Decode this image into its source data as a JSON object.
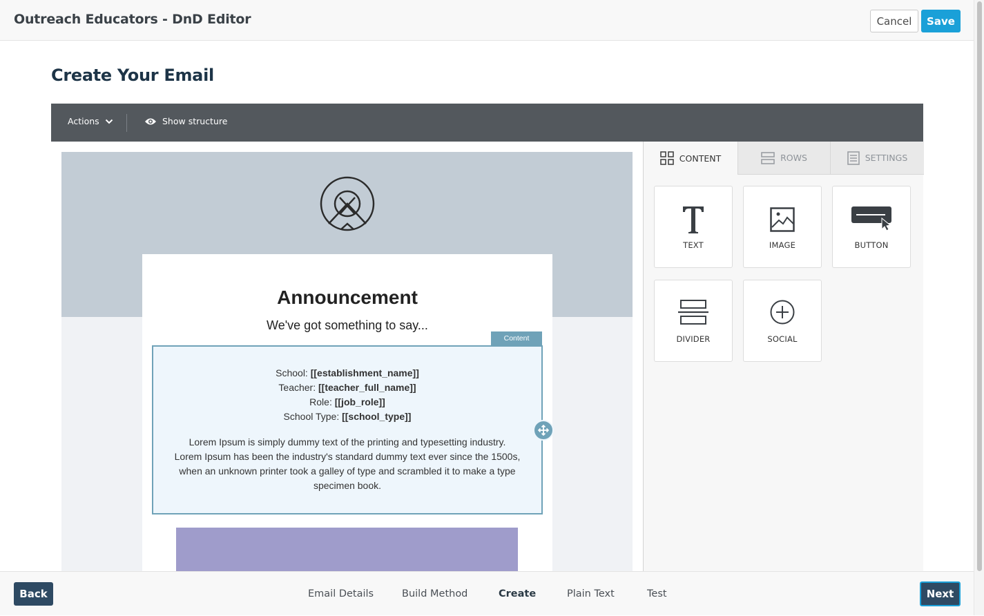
{
  "header": {
    "app_title": "Outreach Educators - DnD Editor",
    "cancel_label": "Cancel",
    "save_label": "Save"
  },
  "page": {
    "title": "Create Your Email"
  },
  "toolbar": {
    "actions_label": "Actions",
    "show_structure_label": "Show structure",
    "icons": [
      "chevron-down-icon",
      "eye-icon"
    ]
  },
  "email": {
    "logo_icon": "logo-icon",
    "heading": "Announcement",
    "subheading": "We've got something to say...",
    "content_tag": "Content",
    "fields": [
      {
        "label": "School: ",
        "value": "[[establishment_name]]"
      },
      {
        "label": "Teacher: ",
        "value": "[[teacher_full_name]]"
      },
      {
        "label": "Role: ",
        "value": "[[job_role]]"
      },
      {
        "label": "School Type: ",
        "value": "[[school_type]]"
      }
    ],
    "body_text": "Lorem Ipsum is simply dummy text of the printing and typesetting industry. Lorem Ipsum has been the industry's standard dummy text ever since the 1500s, when an unknown printer took a galley of type and scrambled it to make a type specimen book."
  },
  "panel": {
    "tabs": [
      {
        "label": "CONTENT",
        "icon": "grid-icon",
        "active": true
      },
      {
        "label": "ROWS",
        "icon": "rows-icon",
        "active": false
      },
      {
        "label": "SETTINGS",
        "icon": "settings-icon",
        "active": false
      }
    ],
    "tiles": [
      {
        "label": "TEXT",
        "icon": "text-icon"
      },
      {
        "label": "IMAGE",
        "icon": "image-icon"
      },
      {
        "label": "BUTTON",
        "icon": "button-icon"
      },
      {
        "label": "DIVIDER",
        "icon": "divider-icon"
      },
      {
        "label": "SOCIAL",
        "icon": "social-icon"
      }
    ]
  },
  "footer": {
    "back_label": "Back",
    "next_label": "Next",
    "steps": [
      {
        "label": "Email Details",
        "current": false
      },
      {
        "label": "Build Method",
        "current": false
      },
      {
        "label": "Create",
        "current": true
      },
      {
        "label": "Plain Text",
        "current": false
      },
      {
        "label": "Test",
        "current": false
      }
    ]
  },
  "colors": {
    "accent": "#1aa0d8",
    "primary_dark": "#2e4a63",
    "toolbar_bg": "#53585d",
    "selection": "#6fa2b8",
    "hero_bg": "#c2ccd5",
    "purple_block": "#9f9ccb"
  }
}
